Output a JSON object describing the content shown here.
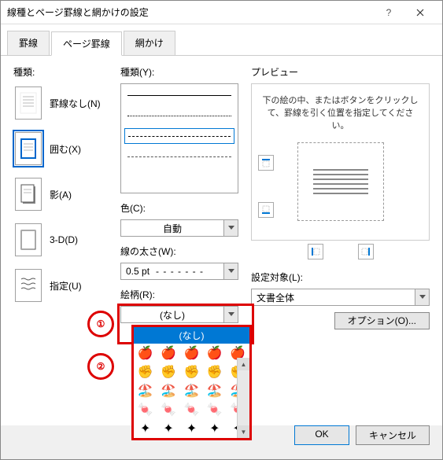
{
  "title": "線種とページ罫線と網かけの設定",
  "tabs": {
    "t1": "罫線",
    "t2": "ページ罫線",
    "t3": "網かけ"
  },
  "left": {
    "label": "種類:",
    "items": [
      {
        "label": "罫線なし(N)"
      },
      {
        "label": "囲む(X)"
      },
      {
        "label": "影(A)"
      },
      {
        "label": "3-D(D)"
      },
      {
        "label": "指定(U)"
      }
    ]
  },
  "mid": {
    "line_style_label": "種類(Y):",
    "color_label": "色(C):",
    "color_value": "自動",
    "width_label": "線の太さ(W):",
    "width_value": "0.5 pt",
    "width_sample": "- - - - - - -",
    "pattern_label": "絵柄(R):",
    "pattern_value": "(なし)"
  },
  "right": {
    "preview_label": "プレビュー",
    "preview_text": "下の絵の中、またはボタンをクリックして、罫線を引く位置を指定してください。",
    "apply_label": "設定対象(L):",
    "apply_value": "文書全体",
    "options_btn": "オプション(O)..."
  },
  "buttons": {
    "ok": "OK",
    "cancel": "キャンセル"
  },
  "dropdown": {
    "none": "(なし)"
  },
  "anno": {
    "b1": "①",
    "b2": "②"
  }
}
